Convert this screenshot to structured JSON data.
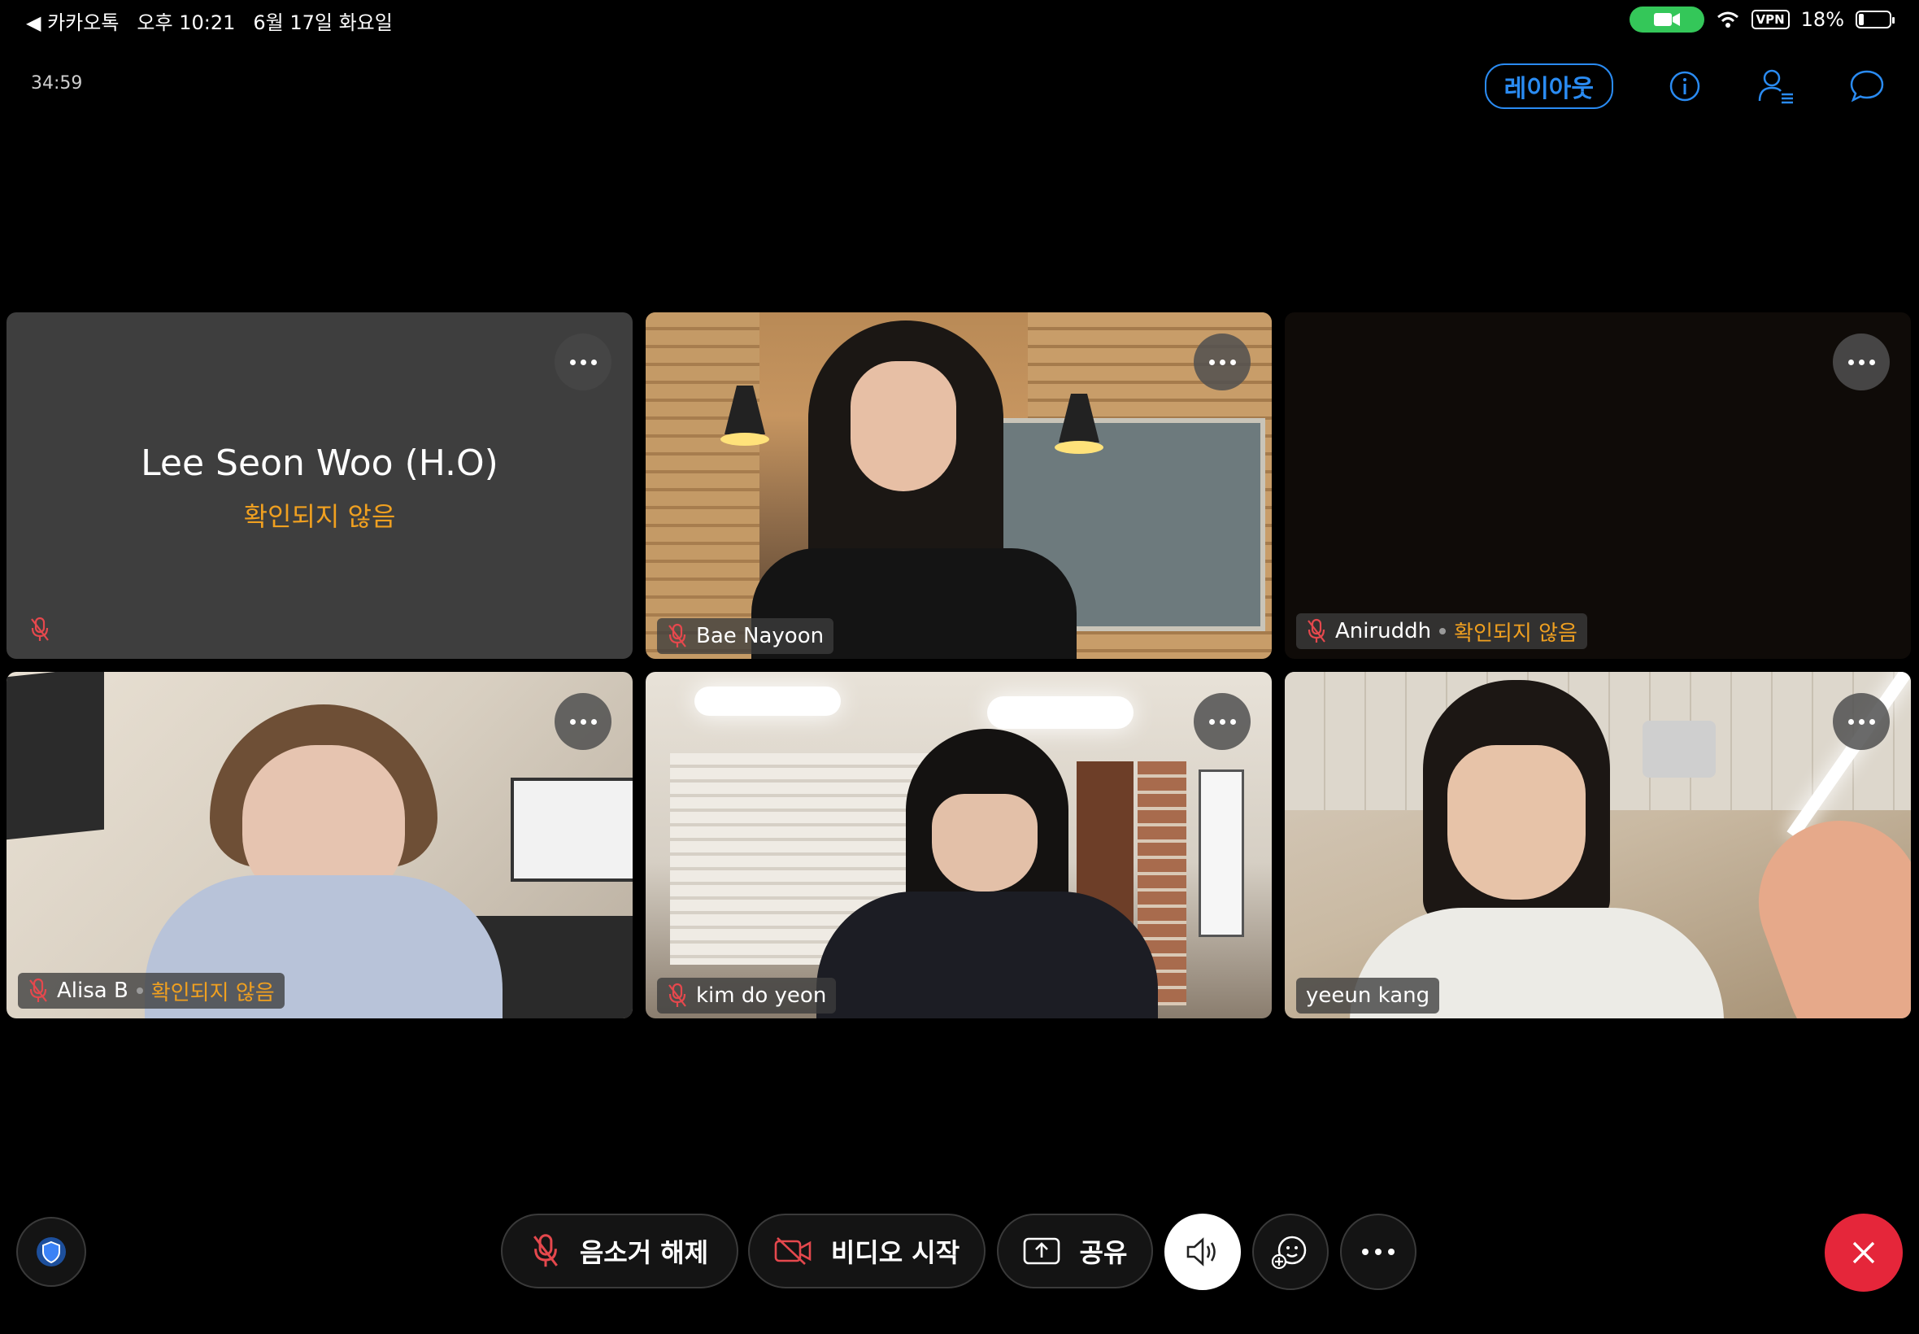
{
  "status_bar": {
    "back_app": "◀ 카카오톡",
    "time": "오후 10:21",
    "date": "6월 17일 화요일",
    "vpn": "VPN",
    "battery": "18%",
    "battery_level": 0.18
  },
  "meeting": {
    "elapsed": "34:59",
    "layout_label": "레이아웃"
  },
  "participants": [
    {
      "name": "Lee Seon Woo (H.O)",
      "status": "확인되지 않음",
      "video": false,
      "muted": true
    },
    {
      "name": "Bae Nayoon",
      "status": "",
      "video": true,
      "muted": true
    },
    {
      "name": "Aniruddh",
      "status": "확인되지 않음",
      "video": true,
      "muted": true
    },
    {
      "name": "Alisa B",
      "status": "확인되지 않음",
      "video": true,
      "muted": true
    },
    {
      "name": "kim do yeon",
      "status": "",
      "video": true,
      "muted": true
    },
    {
      "name": "yeeun kang",
      "status": "",
      "video": true,
      "muted": false
    }
  ],
  "toolbar": {
    "unmute_label": "음소거 해제",
    "start_video_label": "비디오 시작",
    "share_label": "공유"
  },
  "colors": {
    "accent": "#2a8bf2",
    "warning": "#f0a020",
    "muted_icon": "#e5484d",
    "end_call": "#e5263a",
    "camera_pill": "#34c759"
  },
  "icons": [
    "back-arrow-icon",
    "camera-icon",
    "wifi-icon",
    "battery-icon",
    "info-icon",
    "participants-icon",
    "chat-icon",
    "more-icon",
    "mic-off-icon",
    "video-off-icon",
    "share-icon",
    "speaker-icon",
    "reaction-icon",
    "shield-icon",
    "close-icon"
  ]
}
